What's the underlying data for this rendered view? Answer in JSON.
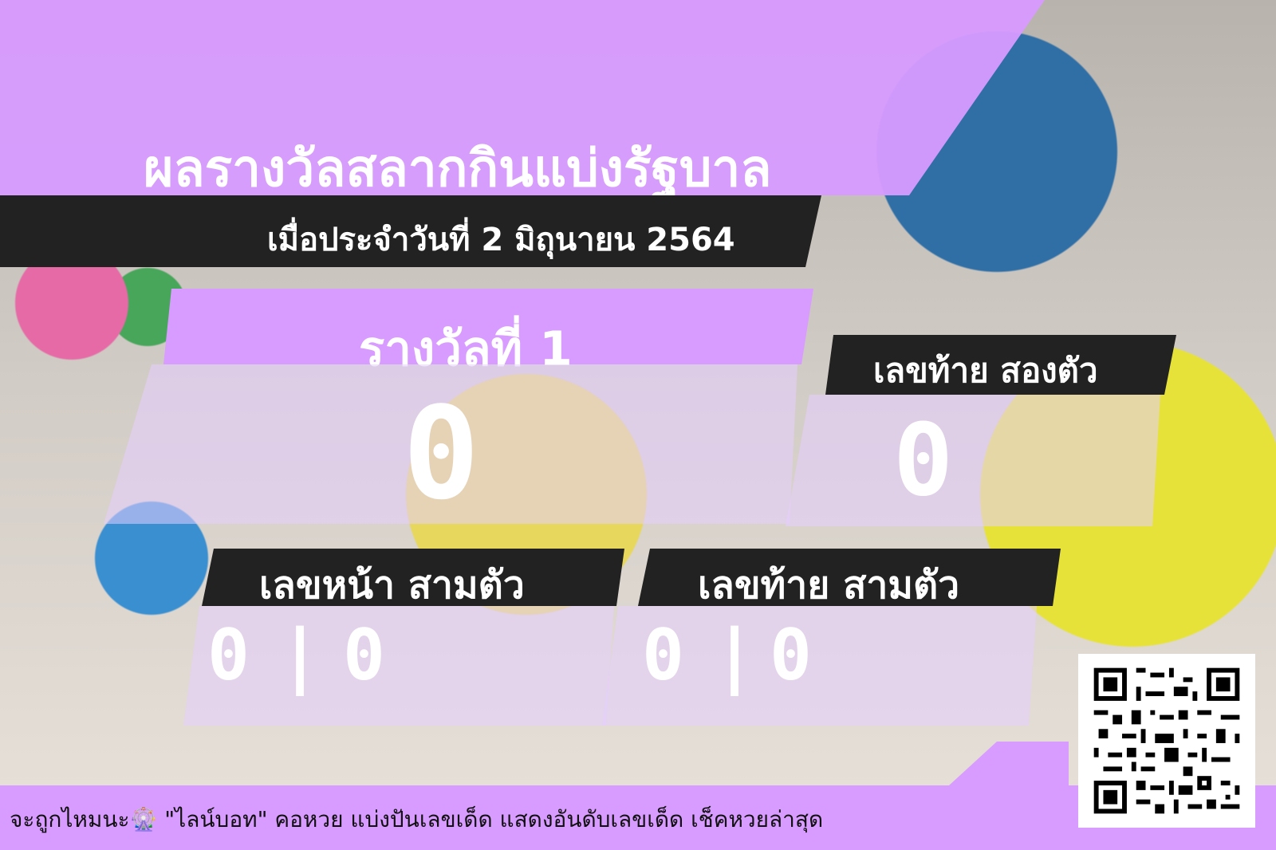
{
  "header": {
    "title": "ผลรางวัลสลากกินแบ่งรัฐบาล",
    "date": "เมื่อประจำวันที่ 2 มิถุนายน 2564"
  },
  "prize_first": {
    "label": "รางวัลที่ 1",
    "value": "0"
  },
  "last_two": {
    "label": "เลขท้าย สองตัว",
    "value": "0"
  },
  "front_three": {
    "label": "เลขหน้า สามตัว",
    "value_a": "0",
    "divider": "|",
    "value_b": "0"
  },
  "last_three": {
    "label": "เลขท้าย สามตัว",
    "value_a": "0",
    "divider": "|",
    "value_b": "0"
  },
  "footer": {
    "text": "จะถูกไหมนะ🎡 \"ไลน์บอท\" คอหวย แบ่งปันเลขเด็ด แสดงอันดับเลขเด็ด เช็คหวยล่าสุด"
  },
  "colors": {
    "accent": "#d89bff",
    "dark": "#222222",
    "text": "#ffffff"
  }
}
